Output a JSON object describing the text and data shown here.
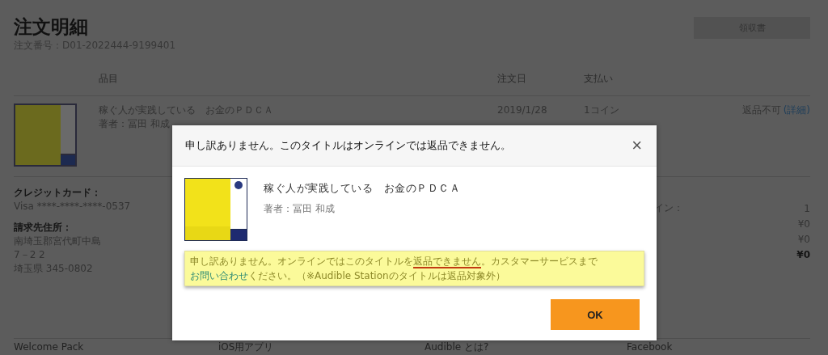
{
  "page": {
    "title": "注文明細",
    "order_number": "注文番号：D01-2022444-9199401",
    "receipt_button": "領収書"
  },
  "table": {
    "columns": [
      "品目",
      "注文日",
      "支払い"
    ],
    "rows": [
      {
        "title": "稼ぐ人が実践している　お金のＰＤＣＡ",
        "author": "著者：冨田 和成",
        "date": "2019/1/28",
        "payment": "1コイン",
        "status": "返品不可",
        "status_link": "(詳細)"
      }
    ]
  },
  "payment_info": [
    {
      "label": "クレジットカード：",
      "lines": [
        "Visa ****-****-****-0537"
      ]
    },
    {
      "label": "請求先住所：",
      "lines": [
        "南埼玉郡宮代町中島",
        "7－2 2",
        "埼玉県 345-0802"
      ]
    }
  ],
  "summary": {
    "label": "イン：",
    "values": [
      {
        "text": "1",
        "bold": false
      },
      {
        "text": "¥0",
        "bold": false
      },
      {
        "text": "¥0",
        "bold": false
      },
      {
        "text": "¥0",
        "bold": true
      }
    ]
  },
  "footer_links": [
    "Welcome Pack",
    "iOS用アプリ",
    "Audible とは?",
    "Facebook"
  ],
  "dialog": {
    "title": "申し訳ありません。このタイトルはオンラインでは返品できません。",
    "close": "×",
    "book_title": "稼ぐ人が実践している　お金のＰＤＣＡ",
    "book_author": "著者：冨田 和成",
    "notice": [
      {
        "kind": "plain",
        "text": "申し訳ありません。オンラインではこのタイトルを"
      },
      {
        "kind": "underlined",
        "text": "返品できません"
      },
      {
        "kind": "plain",
        "text": "。カスタマーサービスまで"
      },
      {
        "kind": "link",
        "text": "お問い合わせ"
      },
      {
        "kind": "plain",
        "text": "ください。（※Audible Stationのタイトルは返品対象外）"
      }
    ],
    "ok_button": "OK"
  }
}
